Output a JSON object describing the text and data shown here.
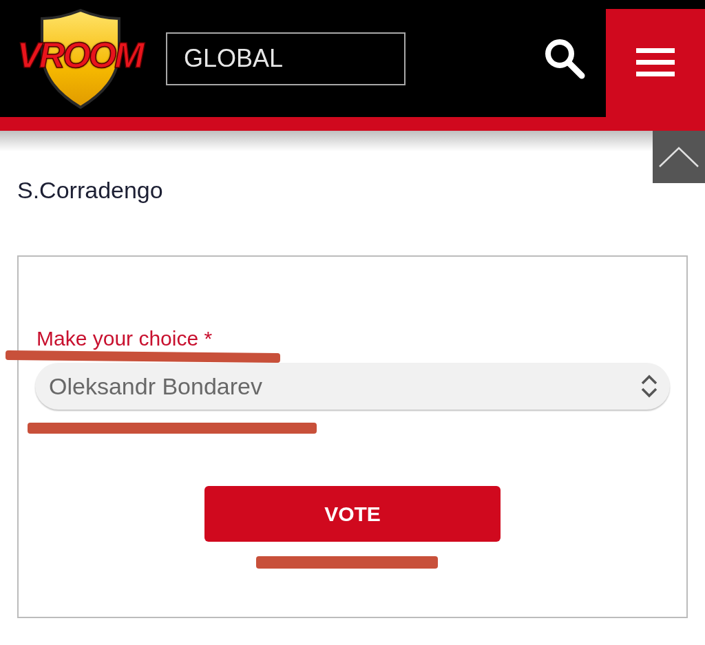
{
  "header": {
    "logo": {
      "text": "VROOM"
    },
    "region_selector": {
      "value": "GLOBAL"
    }
  },
  "page": {
    "title": "S.Corradengo"
  },
  "poll": {
    "field_label": "Make your choice *",
    "dropdown": {
      "value": "Oleksandr Bondarev"
    },
    "button": {
      "label": "VOTE"
    }
  }
}
